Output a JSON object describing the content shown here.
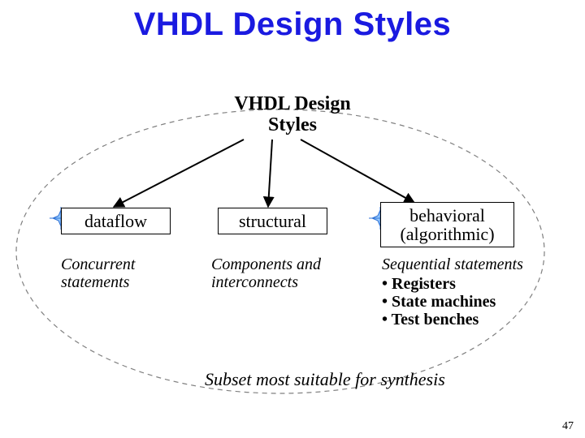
{
  "title": "VHDL Design Styles",
  "root_label_l1": "VHDL Design",
  "root_label_l2": "Styles",
  "nodes": {
    "dataflow": {
      "label": "dataflow",
      "desc_l1": "Concurrent",
      "desc_l2": "statements"
    },
    "structural": {
      "label": "structural",
      "desc_l1": "Components and",
      "desc_l2": "interconnects"
    },
    "behavioral": {
      "label_l1": "behavioral",
      "label_l2": "(algorithmic)",
      "desc_head": "Sequential statements",
      "bullets": [
        "• Registers",
        "• State machines",
        "• Test benches"
      ]
    }
  },
  "caption": "Subset most suitable for synthesis",
  "page_number": "47",
  "colors": {
    "title": "#1a1ae0",
    "ellipse": "#808080"
  }
}
